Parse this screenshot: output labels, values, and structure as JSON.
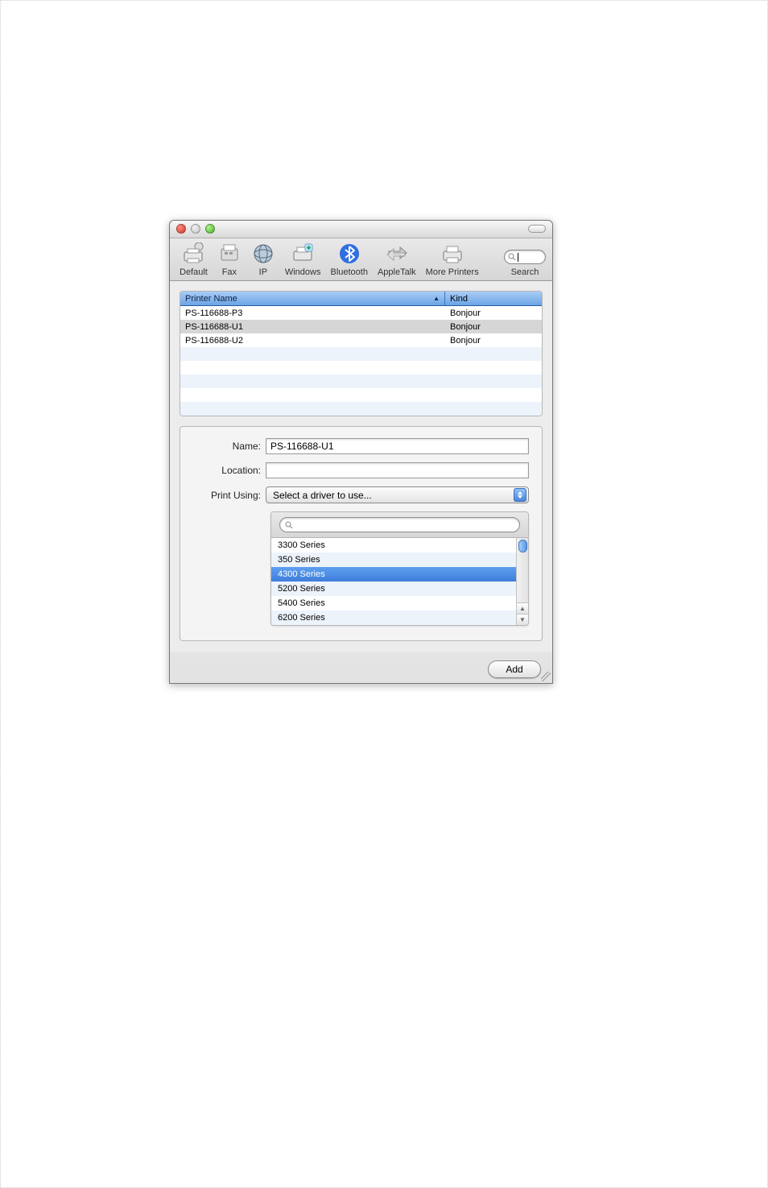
{
  "toolbar": {
    "items": [
      {
        "label": "Default",
        "icon": "printer-default-icon"
      },
      {
        "label": "Fax",
        "icon": "fax-icon"
      },
      {
        "label": "IP",
        "icon": "globe-icon"
      },
      {
        "label": "Windows",
        "icon": "printer-plus-icon"
      },
      {
        "label": "Bluetooth",
        "icon": "bluetooth-icon"
      },
      {
        "label": "AppleTalk",
        "icon": "arrows-exchange-icon"
      },
      {
        "label": "More Printers",
        "icon": "printer-icon"
      }
    ],
    "search_label": "Search",
    "search_value": ""
  },
  "printer_list": {
    "columns": {
      "name": "Printer Name",
      "kind": "Kind"
    },
    "rows": [
      {
        "name": "PS-116688-P3",
        "kind": "Bonjour",
        "selected": false
      },
      {
        "name": "PS-116688-U1",
        "kind": "Bonjour",
        "selected": true
      },
      {
        "name": "PS-116688-U2",
        "kind": "Bonjour",
        "selected": false
      }
    ]
  },
  "form": {
    "name_label": "Name:",
    "name_value": "PS-116688-U1",
    "location_label": "Location:",
    "location_value": "",
    "print_using_label": "Print Using:",
    "print_using_value": "Select a driver to use..."
  },
  "driver_list": {
    "search_value": "",
    "items": [
      {
        "label": "3300 Series",
        "selected": false
      },
      {
        "label": "350 Series",
        "selected": false
      },
      {
        "label": "4300 Series",
        "selected": true
      },
      {
        "label": "5200 Series",
        "selected": false
      },
      {
        "label": "5400 Series",
        "selected": false
      },
      {
        "label": "6200 Series",
        "selected": false
      }
    ]
  },
  "buttons": {
    "add": "Add"
  }
}
